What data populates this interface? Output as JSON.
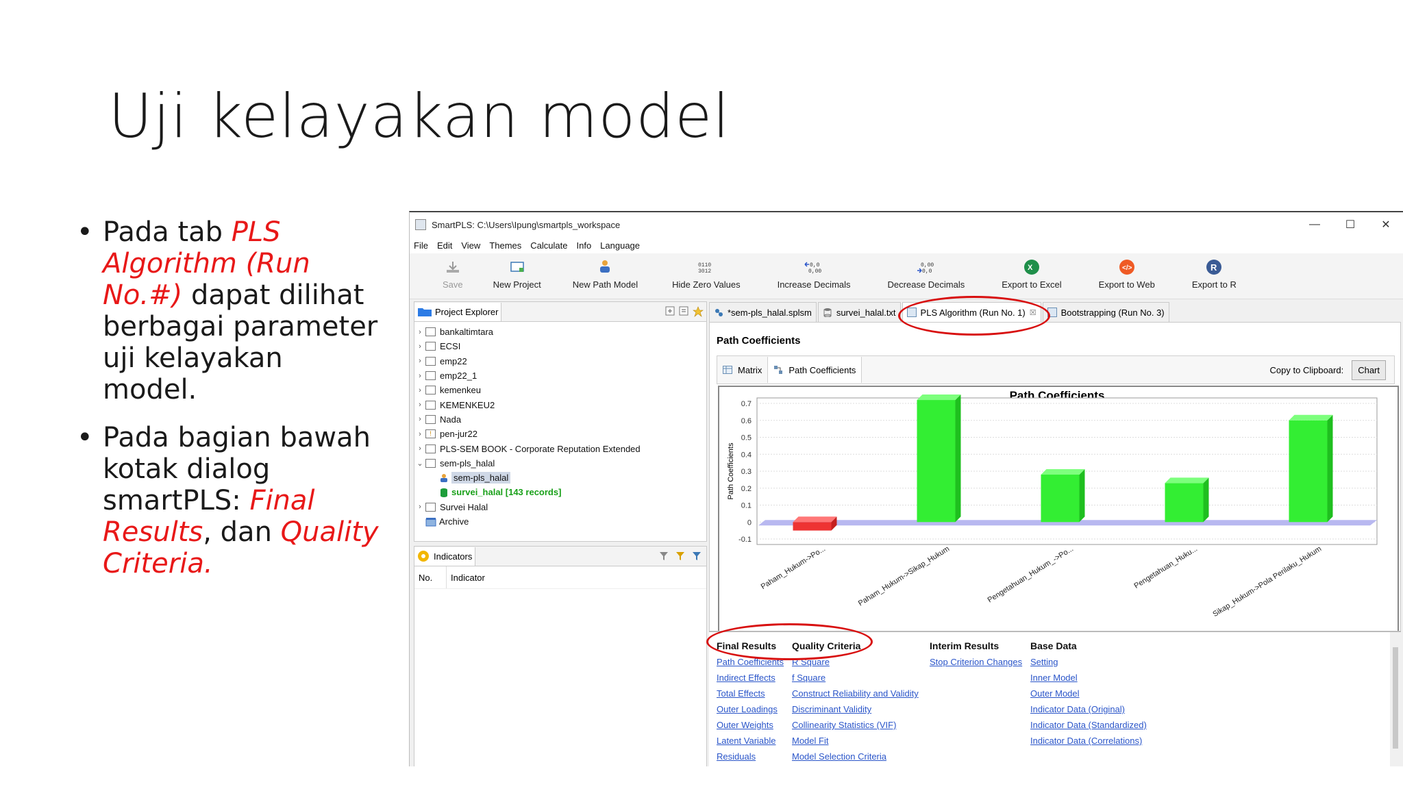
{
  "slide": {
    "title": "Uji kelayakan model",
    "bullet1": {
      "a": "Pada tab ",
      "b": "PLS Algorithm (Run No.#)",
      "c": " dapat dilihat berbagai parameter uji kelayakan model."
    },
    "bullet2": {
      "a": "Pada bagian bawah kotak dialog smartPLS: ",
      "b": "Final Results",
      "c": ", dan ",
      "d": "Quality Criteria",
      "e": "."
    }
  },
  "window": {
    "title": "SmartPLS: C:\\Users\\Ipung\\smartpls_workspace",
    "controls": {
      "min": "—",
      "max": "☐",
      "close": "✕"
    },
    "menu": [
      "File",
      "Edit",
      "View",
      "Themes",
      "Calculate",
      "Info",
      "Language"
    ],
    "toolbar": [
      "Save",
      "New Project",
      "New Path Model",
      "Hide Zero Values",
      "Increase Decimals",
      "Decrease Decimals",
      "Export to Excel",
      "Export to Web",
      "Export to R"
    ]
  },
  "project_explorer": {
    "label": "Project Explorer",
    "items": [
      {
        "label": "bankaltimtara"
      },
      {
        "label": "ECSI"
      },
      {
        "label": "emp22"
      },
      {
        "label": "emp22_1"
      },
      {
        "label": "kemenkeu"
      },
      {
        "label": "KEMENKEU2"
      },
      {
        "label": "Nada"
      },
      {
        "label": "pen-jur22"
      },
      {
        "label": "PLS-SEM BOOK - Corporate Reputation Extended"
      },
      {
        "label": "sem-pls_halal"
      },
      {
        "label": "sem-pls_halal"
      },
      {
        "label": "survei_halal [143 records]"
      },
      {
        "label": "Survei Halal"
      },
      {
        "label": "Archive"
      }
    ]
  },
  "indicators": {
    "label": "Indicators",
    "col_no": "No.",
    "col_indicator": "Indicator"
  },
  "tabs": [
    "*sem-pls_halal.splsm",
    "survei_halal.txt",
    "PLS Algorithm (Run No. 1)",
    "Bootstrapping (Run No. 3)"
  ],
  "tab_close": "☒",
  "editor": {
    "heading": "Path Coefficients",
    "subtab_matrix": "Matrix",
    "subtab_path": "Path Coefficients",
    "copy_label": "Copy to Clipboard:",
    "chart_button": "Chart"
  },
  "chart_data": {
    "type": "bar",
    "title": "Path Coefficients",
    "ylabel": "Path Coefficients",
    "xlabel": "",
    "categories": [
      "Paham_Hukum->Po...",
      "Paham_Hukum->Sikap_Hukum",
      "Pengetahuan_Hukum_->Po...",
      "Pengetahuan_Huku...",
      "Sikap_Hukum->Pola Perilaku_Hukum"
    ],
    "values": [
      -0.05,
      0.72,
      0.28,
      0.23,
      0.6
    ],
    "ylim": [
      -0.1,
      0.7
    ],
    "yticks": [
      "0.7",
      "0.6",
      "0.5",
      "0.4",
      "0.3",
      "0.2",
      "0.1",
      "0",
      "-0.1"
    ],
    "colors": {
      "positive": "#33ee33",
      "negative": "#ee3333",
      "floor": "#b8b8f0"
    }
  },
  "results": {
    "final": {
      "title": "Final Results",
      "links": [
        "Path Coefficients",
        "Indirect Effects",
        "Total Effects",
        "Outer Loadings",
        "Outer Weights",
        "Latent Variable",
        "Residuals"
      ]
    },
    "quality": {
      "title": "Quality Criteria",
      "links": [
        "R Square",
        "f Square",
        "Construct Reliability and Validity",
        "Discriminant Validity",
        "Collinearity Statistics (VIF)",
        "Model Fit",
        "Model Selection Criteria"
      ]
    },
    "interim": {
      "title": "Interim Results",
      "links": [
        "Stop Criterion Changes"
      ]
    },
    "base": {
      "title": "Base Data",
      "links": [
        "Setting",
        "Inner Model",
        "Outer Model",
        "Indicator Data (Original)",
        "Indicator Data (Standardized)",
        "Indicator Data (Correlations)"
      ]
    }
  }
}
